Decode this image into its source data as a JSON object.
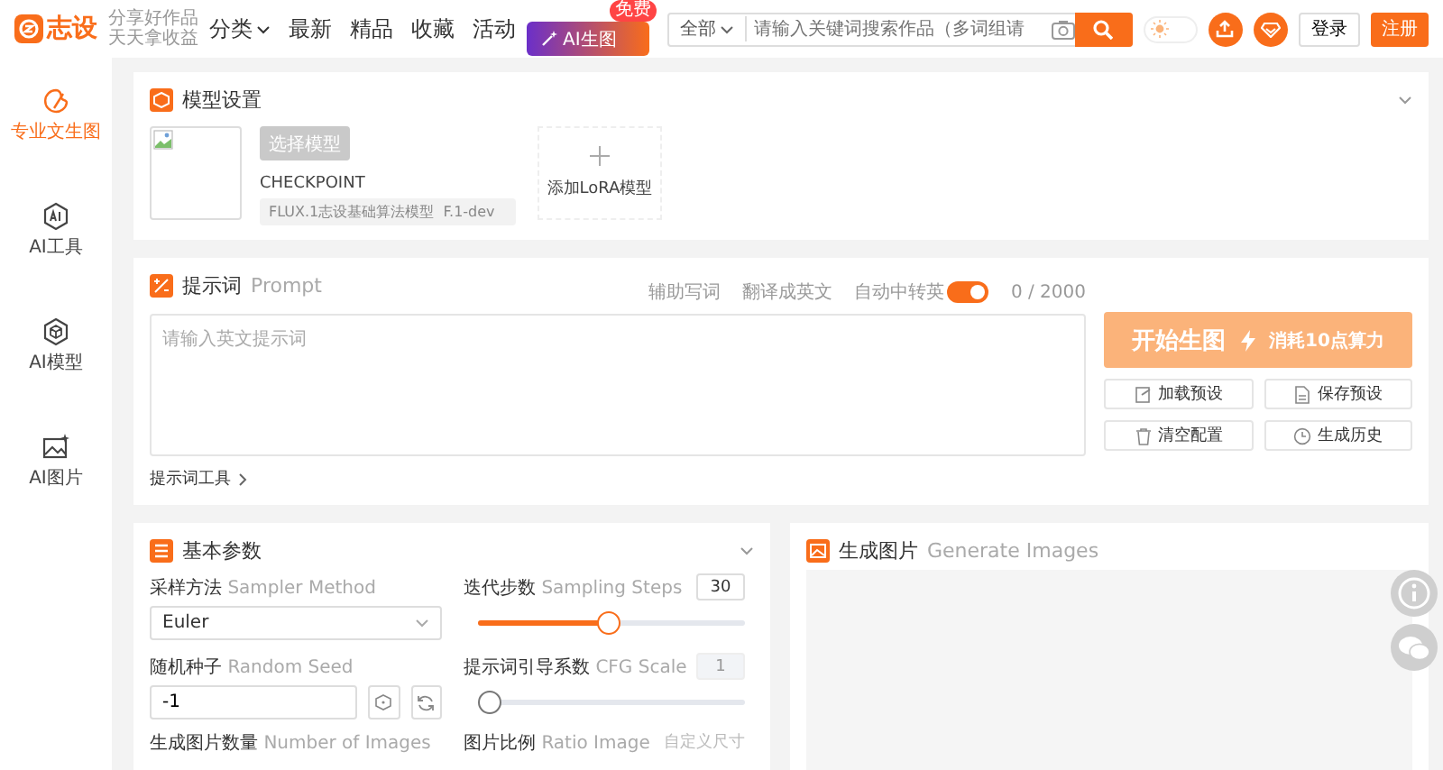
{
  "header": {
    "logo": "志设",
    "slogan": [
      "分享好作品",
      "天天拿收益"
    ],
    "nav": [
      {
        "label": "分类",
        "dropdown": true
      },
      {
        "label": "最新",
        "dropdown": false
      },
      {
        "label": "精品",
        "dropdown": false
      },
      {
        "label": "收藏",
        "dropdown": false
      },
      {
        "label": "活动",
        "dropdown": false
      }
    ],
    "ai_button": {
      "label": "AI生图",
      "badge": "免费"
    },
    "search": {
      "scope": "全部",
      "placeholder": "请输入关键词搜索作品（多词组请"
    },
    "theme_toggle": {
      "on": false
    },
    "login": "登录",
    "register": "注册"
  },
  "sidebar": {
    "items": [
      {
        "label": "专业文生图",
        "selected": true
      },
      {
        "label": "AI工具",
        "selected": false
      },
      {
        "label": "AI模型",
        "selected": false
      },
      {
        "label": "AI图片",
        "selected": false
      }
    ]
  },
  "model_panel": {
    "title": "模型设置",
    "select_button": "选择模型",
    "checkpoint_label": "CHECKPOINT",
    "checkpoint_value": "FLUX.1志设基础算法模型  F.1-dev",
    "add_lora": "添加LoRA模型"
  },
  "prompt_panel": {
    "title": "提示词",
    "subtitle": "Prompt",
    "tools": [
      "辅助写词",
      "翻译成英文"
    ],
    "auto_translate": {
      "label": "自动中转英",
      "on": true
    },
    "counter": "0 / 2000",
    "placeholder": "请输入英文提示词",
    "prompt_tools": "提示词工具",
    "generate": {
      "label": "开始生图",
      "cost": "消耗10点算力"
    },
    "actions": [
      "加载预设",
      "保存预设",
      "清空配置",
      "生成历史"
    ]
  },
  "params_panel": {
    "title": "基本参数",
    "fields": [
      {
        "kind": "select",
        "label": "采样方法",
        "sublabel": "Sampler Method",
        "value": "Euler"
      },
      {
        "kind": "slider",
        "label": "迭代步数",
        "sublabel": "Sampling Steps",
        "value": "30",
        "level": 0.49,
        "disabled": false
      },
      {
        "kind": "seed",
        "label": "随机种子",
        "sublabel": "Random Seed",
        "value": "-1"
      },
      {
        "kind": "slider",
        "label": "提示词引导系数",
        "sublabel": "CFG Scale",
        "value": "1",
        "level": 0,
        "disabled": true
      },
      {
        "kind": "label",
        "label": "生成图片数量",
        "sublabel": "Number of Images"
      },
      {
        "kind": "label",
        "label": "图片比例",
        "sublabel": "Ratio Image",
        "note": "自定义尺寸"
      }
    ]
  },
  "output_panel": {
    "title": "生成图片",
    "subtitle": "Generate Images"
  }
}
